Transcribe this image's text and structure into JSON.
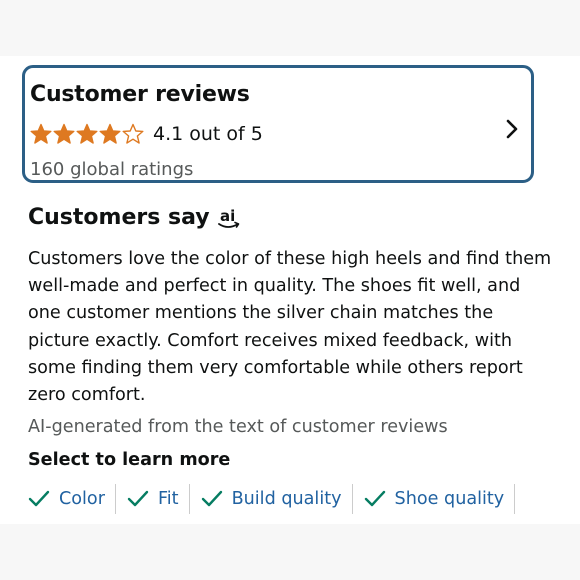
{
  "reviews": {
    "title": "Customer reviews",
    "rating": 4.1,
    "rating_max": 5,
    "rating_text": "4.1 out of 5",
    "global_ratings": "160 global ratings",
    "star_color": "#de7921"
  },
  "customers_say": {
    "title": "Customers say",
    "summary": "Customers love the color of these high heels and find them well-made and perfect in quality. The shoes fit well, and one customer mentions the silver chain matches the picture exactly. Comfort receives mixed feedback, with some finding them very comfortable while others report zero comfort.",
    "ai_note": "AI-generated from the text of customer reviews",
    "learn_more": "Select to learn more",
    "aspects": [
      {
        "label": "Color"
      },
      {
        "label": "Fit"
      },
      {
        "label": "Build quality"
      },
      {
        "label": "Shoe quality"
      }
    ]
  },
  "colors": {
    "card_border": "#2c5f86",
    "link": "#2162a1",
    "check": "#067d62"
  }
}
